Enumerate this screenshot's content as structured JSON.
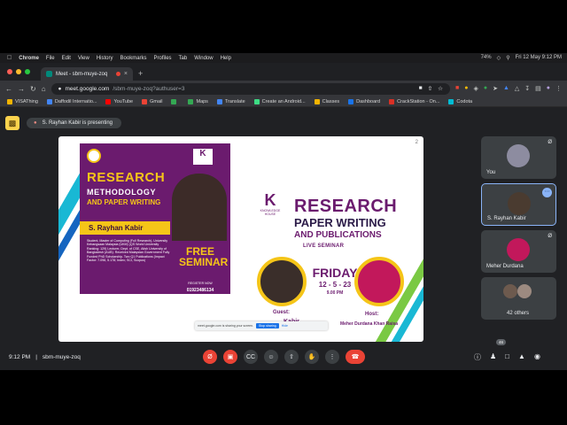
{
  "menubar": {
    "items": [
      "Chrome",
      "File",
      "Edit",
      "View",
      "History",
      "Bookmarks",
      "Profiles",
      "Tab",
      "Window",
      "Help"
    ],
    "battery": "74%",
    "datetime": "Fri 12 May 9:12 PM"
  },
  "browser": {
    "tab_title": "Meet - sbm-muye-zoq",
    "url_host": "meet.google.com",
    "url_path": "/sbm-muye-zoq?authuser=3"
  },
  "bookmarks": [
    {
      "label": "VISAThing",
      "color": "#f4b400"
    },
    {
      "label": "Daffodil Internatio...",
      "color": "#4285f4"
    },
    {
      "label": "YouTube",
      "color": "#ff0000"
    },
    {
      "label": "Gmail",
      "color": "#ea4335"
    },
    {
      "label": "",
      "color": "#34a853"
    },
    {
      "label": "Maps",
      "color": "#34a853"
    },
    {
      "label": "Translate",
      "color": "#4285f4"
    },
    {
      "label": "Create an Android...",
      "color": "#3ddc84"
    },
    {
      "label": "Classes",
      "color": "#f4b400"
    },
    {
      "label": "Dashboard",
      "color": "#1a73e8"
    },
    {
      "label": "CrackStation - On...",
      "color": "#d93025"
    },
    {
      "label": "Codota",
      "color": "#00bcd4"
    }
  ],
  "meet": {
    "presenting": "S. Rayhan Kabir is presenting",
    "slide_page": "2",
    "poster": {
      "title1": "RESEARCH",
      "title2": "METHODOLOGY",
      "title3": "AND PAPER WRITING",
      "name": "S. Rayhan Kabir",
      "bio": "Student, Master of Computing (Full Research), University Kebangsaan Malaysia (UKM) (QS World University Ranking: 129) Lecturer, Dept. of CSE, Atish University of Bangladesh (AUB). Received Malaysian Government Fully Funded PhD Scholarship. Two Q1 Publications (Impact Factor: 7.098, 5.178; Index; SCI, Scopus)",
      "free": "FREE SEMINAR",
      "register": "REGISTER NOW",
      "phone": "01923486134"
    },
    "slide": {
      "k_caption": "KNOWLEDGE HOUSE",
      "title1": "RESEARCH",
      "title2": "PAPER WRITING",
      "title3": "AND PUBLICATIONS",
      "live": "LIVE SEMINAR",
      "day": "FRIDAY",
      "date": "12 - 5 - 23",
      "time": "9.00 PM",
      "guest_label": "Guest:",
      "guest_name": "Kabir",
      "host_label": "Host:",
      "host_name": "Meher Durdana Khan Raisa"
    },
    "sharing_bar": {
      "text": "meet.google.com is sharing your screen.",
      "stop": "Stop sharing",
      "hide": "Hide"
    },
    "participants": [
      {
        "name": "You",
        "muted": true,
        "color": "#8d8ca0"
      },
      {
        "name": "S. Rayhan Kabir",
        "muted": false,
        "color": "#4a3b30"
      },
      {
        "name": "Meher Durdana",
        "muted": true,
        "color": "#c2185b"
      },
      {
        "name": "42 others",
        "muted": false,
        "color": "#6d5a4e"
      }
    ],
    "bottom": {
      "time": "9:12 PM",
      "code": "sbm-muye-zoq",
      "people_count": "46"
    }
  }
}
